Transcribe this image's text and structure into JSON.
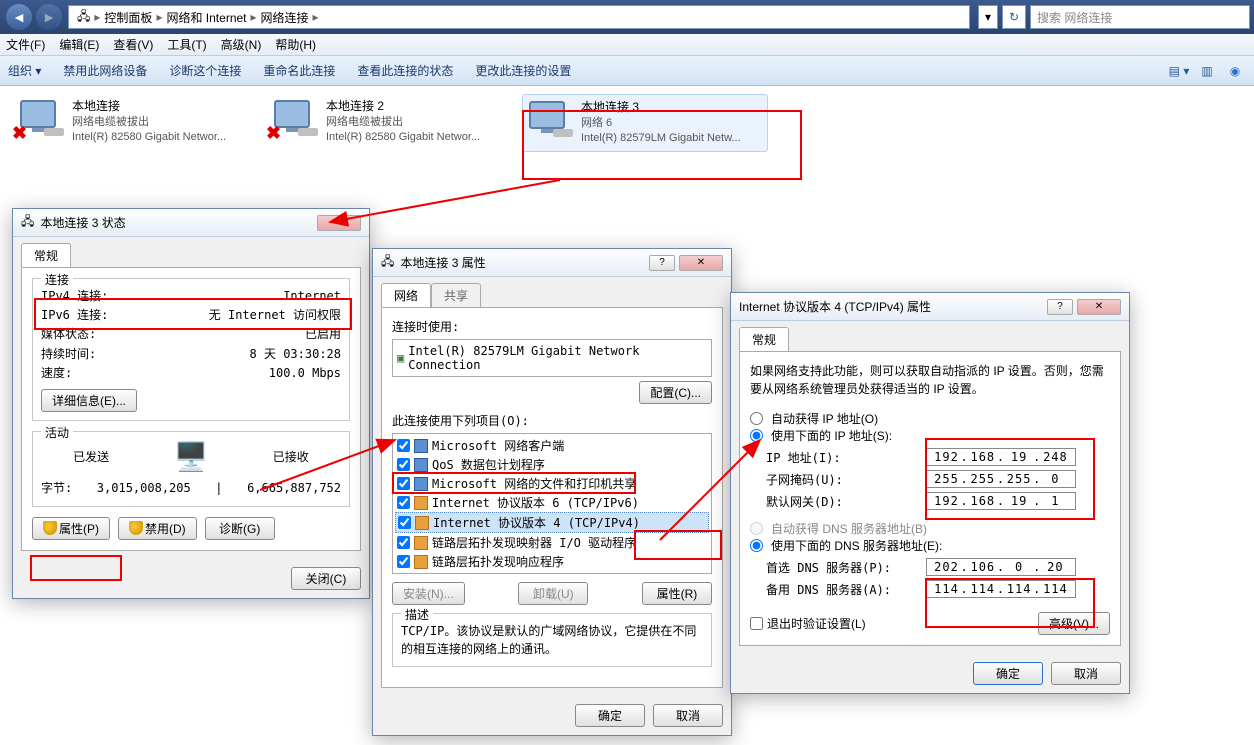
{
  "nav": {
    "breadcrumb": [
      "控制面板",
      "网络和 Internet",
      "网络连接"
    ],
    "search_placeholder": "搜索 网络连接"
  },
  "menu": {
    "items": [
      "文件(F)",
      "编辑(E)",
      "查看(V)",
      "工具(T)",
      "高级(N)",
      "帮助(H)"
    ]
  },
  "toolbar": {
    "items": [
      "组织 ▾",
      "禁用此网络设备",
      "诊断这个连接",
      "重命名此连接",
      "查看此连接的状态",
      "更改此连接的设置"
    ]
  },
  "connections": [
    {
      "name": "本地连接",
      "status": "网络电缆被拔出",
      "adapter": "Intel(R) 82580 Gigabit Networ...",
      "hasX": true
    },
    {
      "name": "本地连接 2",
      "status": "网络电缆被拔出",
      "adapter": "Intel(R) 82580 Gigabit Networ...",
      "hasX": true
    },
    {
      "name": "本地连接 3",
      "status": "网络 6",
      "adapter": "Intel(R) 82579LM Gigabit Netw...",
      "hasX": false
    }
  ],
  "status_dlg": {
    "title": "本地连接 3 状态",
    "tab": "常规",
    "group1": "连接",
    "ipv4_lbl": "IPv4 连接:",
    "ipv4_val": "Internet",
    "ipv6_lbl": "IPv6 连接:",
    "ipv6_val": "无 Internet 访问权限",
    "media_lbl": "媒体状态:",
    "media_val": "已启用",
    "dur_lbl": "持续时间:",
    "dur_val": "8 天 03:30:28",
    "speed_lbl": "速度:",
    "speed_val": "100.0 Mbps",
    "details_btn": "详细信息(E)...",
    "group2": "活动",
    "sent": "已发送",
    "recv": "已接收",
    "bytes_lbl": "字节:",
    "sent_val": "3,015,008,205",
    "recv_val": "6,665,887,752",
    "props_btn": "属性(P)",
    "disable_btn": "禁用(D)",
    "diag_btn": "诊断(G)",
    "close_btn": "关闭(C)"
  },
  "props_dlg": {
    "title": "本地连接 3 属性",
    "tab1": "网络",
    "tab2": "共享",
    "connect_lbl": "连接时使用:",
    "adapter": "Intel(R) 82579LM Gigabit Network Connection",
    "config_btn": "配置(C)...",
    "items_lbl": "此连接使用下列项目(O):",
    "items": [
      "Microsoft 网络客户端",
      "QoS 数据包计划程序",
      "Microsoft 网络的文件和打印机共享",
      "Internet 协议版本 6 (TCP/IPv6)",
      "Internet 协议版本 4 (TCP/IPv4)",
      "链路层拓扑发现映射器 I/O 驱动程序",
      "链路层拓扑发现响应程序"
    ],
    "install_btn": "安装(N)...",
    "uninstall_btn": "卸载(U)",
    "props_btn": "属性(R)",
    "desc_lbl": "描述",
    "desc": "TCP/IP。该协议是默认的广域网络协议，它提供在不同的相互连接的网络上的通讯。",
    "ok": "确定",
    "cancel": "取消"
  },
  "ipv4_dlg": {
    "title": "Internet 协议版本 4 (TCP/IPv4) 属性",
    "tab": "常规",
    "intro": "如果网络支持此功能，则可以获取自动指派的 IP 设置。否则，您需要从网络系统管理员处获得适当的 IP 设置。",
    "auto_ip": "自动获得 IP 地址(O)",
    "use_ip": "使用下面的 IP 地址(S):",
    "ip_lbl": "IP 地址(I):",
    "ip_val": [
      "192",
      "168",
      "19",
      "248"
    ],
    "mask_lbl": "子网掩码(U):",
    "mask_val": [
      "255",
      "255",
      "255",
      "0"
    ],
    "gw_lbl": "默认网关(D):",
    "gw_val": [
      "192",
      "168",
      "19",
      "1"
    ],
    "auto_dns": "自动获得 DNS 服务器地址(B)",
    "use_dns": "使用下面的 DNS 服务器地址(E):",
    "dns1_lbl": "首选 DNS 服务器(P):",
    "dns1_val": [
      "202",
      "106",
      "0",
      "20"
    ],
    "dns2_lbl": "备用 DNS 服务器(A):",
    "dns2_val": [
      "114",
      "114",
      "114",
      "114"
    ],
    "validate": "退出时验证设置(L)",
    "advanced": "高级(V)...",
    "ok": "确定",
    "cancel": "取消"
  }
}
